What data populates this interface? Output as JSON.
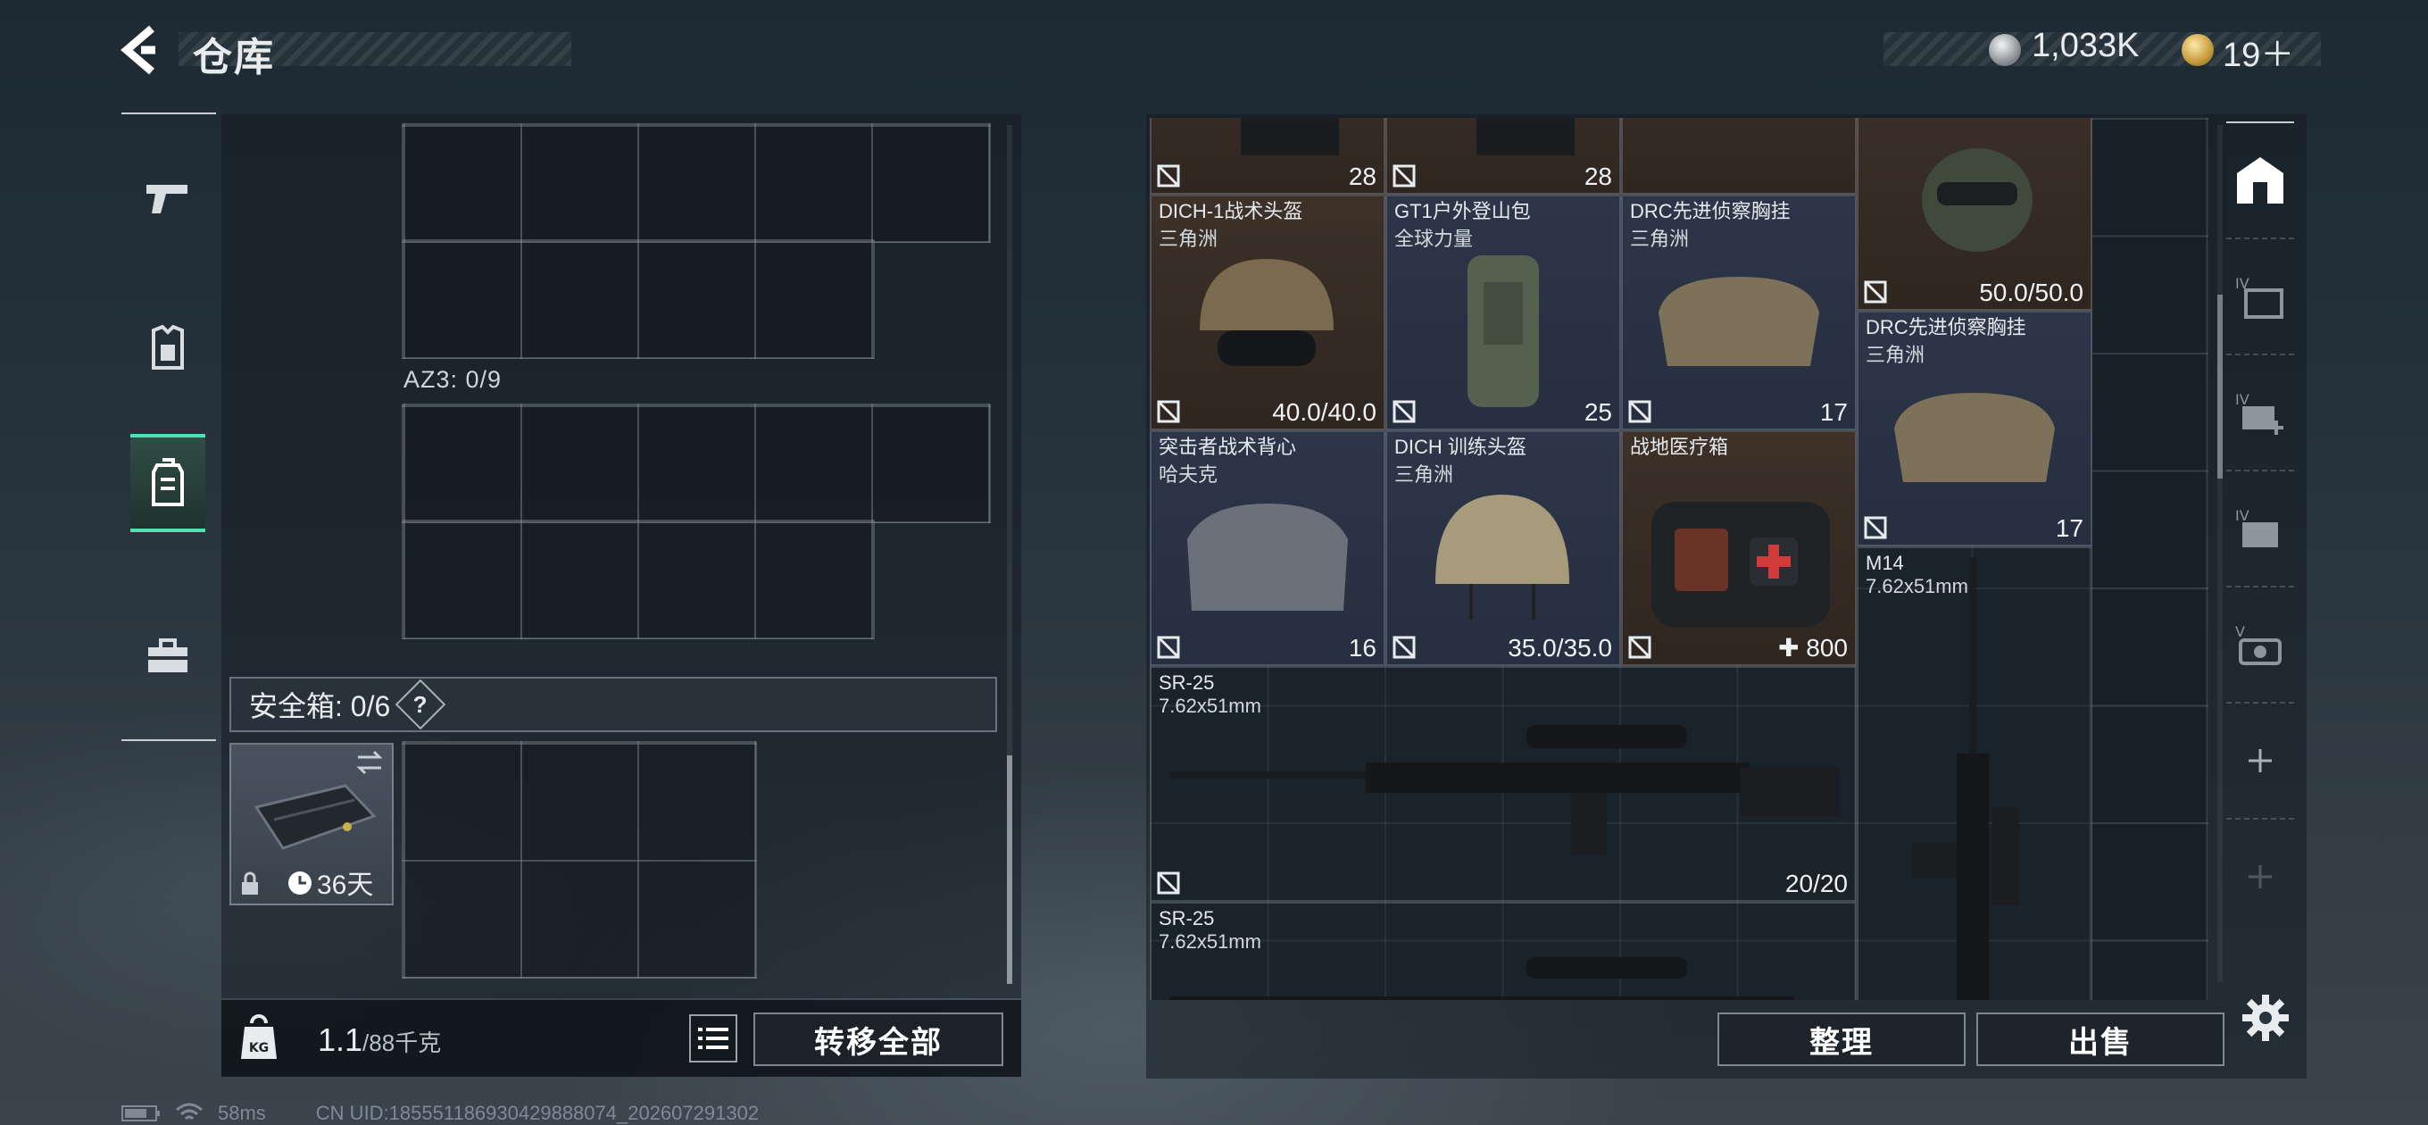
{
  "header": {
    "title": "仓库",
    "currency_silver": "1,033K",
    "currency_gold": "19＋"
  },
  "left": {
    "container_label": "AZ3: 0/9",
    "safebox_label": "安全箱: 0/6",
    "safebox_help": "?",
    "safebox_timer": "36天",
    "weight_value": "1.1",
    "weight_max": "/88千克",
    "transfer_all": "转移全部"
  },
  "stash_items": [
    {
      "name": "",
      "sub": "",
      "value": "28"
    },
    {
      "name": "",
      "sub": "",
      "value": "28"
    },
    {
      "name": "",
      "sub": "",
      "value": "50.0/50.0"
    },
    {
      "name": "DICH-1战术头盔",
      "sub": "三角洲",
      "value": "40.0/40.0"
    },
    {
      "name": "GT1户外登山包",
      "sub": "全球力量",
      "value": "25"
    },
    {
      "name": "DRC先进侦察胸挂",
      "sub": "三角洲",
      "value": "17"
    },
    {
      "name": "DRC先进侦察胸挂",
      "sub": "三角洲",
      "value": "17"
    },
    {
      "name": "突击者战术背心",
      "sub": "哈夫克",
      "value": "16"
    },
    {
      "name": "DICH 训练头盔",
      "sub": "三角洲",
      "value": "35.0/35.0"
    },
    {
      "name": "战地医疗箱",
      "sub": "",
      "value": "800"
    },
    {
      "name": "M14",
      "sub": "7.62x51mm",
      "value": ""
    },
    {
      "name": "SR-25",
      "sub": "7.62x51mm",
      "value": "20/20"
    },
    {
      "name": "SR-25",
      "sub": "7.62x51mm",
      "value": ""
    }
  ],
  "actions": {
    "sort": "整理",
    "sell": "出售"
  },
  "icons": {
    "left_tabs": [
      "pistol-icon",
      "armor-icon",
      "backpack-icon",
      "toolbox-icon"
    ],
    "right_tabs": [
      "home-icon",
      "storage-iv-icon",
      "storage-iv-add-icon",
      "storage-iv-tag-icon",
      "storage-v-icon",
      "add-icon",
      "add-icon"
    ],
    "accent": "#4ee2b0"
  },
  "status": {
    "ping": "58ms",
    "uid": "CN UID:18555118693042988807​4_202607291302"
  }
}
